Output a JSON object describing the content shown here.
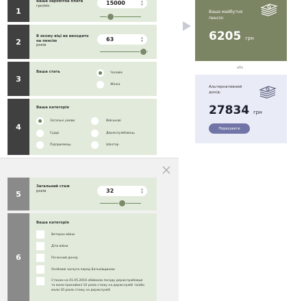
{
  "steps": [
    {
      "number": "1",
      "label_line1": "грн/міс",
      "value": "15000"
    },
    {
      "number": "2",
      "label": "В якому віці ви виходите на пенсію",
      "unit": "років",
      "value": "63"
    },
    {
      "number": "3",
      "label": "Ваша стать",
      "options": [
        "Чоловік",
        "Жінка"
      ],
      "selected": 0
    },
    {
      "number": "4",
      "label": "Ваша категорія",
      "options": [
        "Загальні умови",
        "Військові",
        "Судді",
        "Держслужбовець",
        "Підприємець",
        "Шахтар"
      ],
      "selected": 0
    }
  ],
  "modal_steps": [
    {
      "number": "5",
      "label": "Загальний стаж",
      "unit": "років",
      "value": "32"
    },
    {
      "number": "6",
      "label": "Ваша категорія",
      "checkboxes": [
        "Ветеран війни",
        "Діти війни",
        "Почесний донор",
        "Особливі заслуги перед Батьківщиною",
        "Станом на 01.05.2016 обіймали посаду держслужбовця та мали принаймні 10 років стажу на держслужбі та/або мали 20 років стажу на держслужбі"
      ]
    }
  ],
  "result": {
    "pension_label": "Ваша майбутня пенсія:",
    "pension_value": "6205",
    "currency": "грн",
    "or": "або",
    "alt_label": "Альтернативний дохід:",
    "alt_value": "27834",
    "calc_button": "Порахувати"
  },
  "colors": {
    "dark_panel": "#404040",
    "light_panel": "#e2ebdb",
    "olive": "#7b8463",
    "lavender": "#e9ebf6",
    "button": "#7074a6"
  }
}
